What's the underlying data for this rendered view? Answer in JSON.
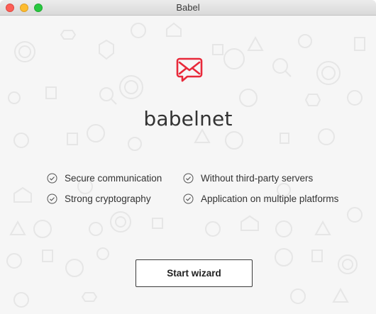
{
  "window": {
    "title": "Babel"
  },
  "brand": {
    "name": "babelnet",
    "accent_color": "#e8293a",
    "icon": "envelope-bubble-icon"
  },
  "features": [
    {
      "label": "Secure communication",
      "icon": "check-circle-icon"
    },
    {
      "label": "Without third-party servers",
      "icon": "check-circle-icon"
    },
    {
      "label": "Strong cryptography",
      "icon": "check-circle-icon"
    },
    {
      "label": "Application on multiple platforms",
      "icon": "check-circle-icon"
    }
  ],
  "actions": {
    "start_wizard": "Start wizard"
  }
}
